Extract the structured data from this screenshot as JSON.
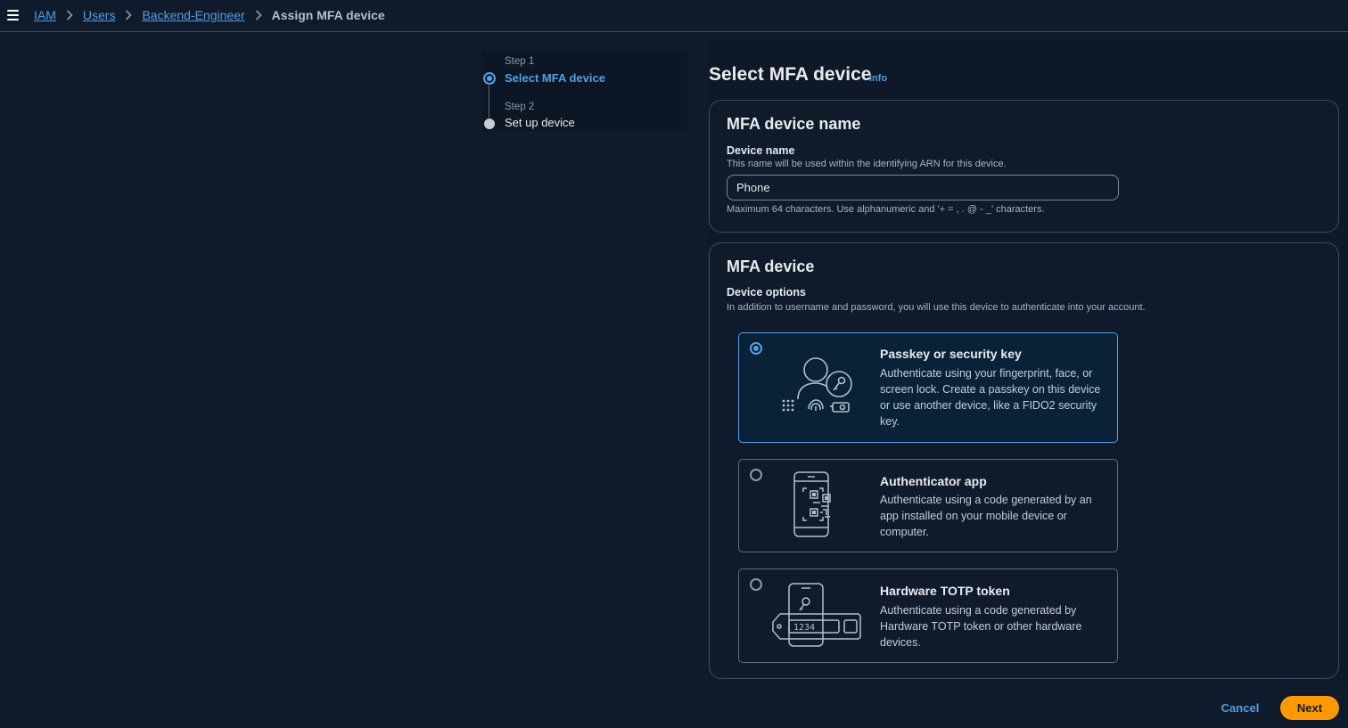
{
  "breadcrumb": {
    "items": [
      "IAM",
      "Users",
      "Backend-Engineer"
    ],
    "current": "Assign MFA device"
  },
  "steps": [
    {
      "label": "Step 1",
      "name": "Select MFA device",
      "state": "active"
    },
    {
      "label": "Step 2",
      "name": "Set up device",
      "state": "pending"
    }
  ],
  "page": {
    "title": "Select MFA device",
    "info": "Info"
  },
  "device_name_section": {
    "heading": "MFA device name",
    "label": "Device name",
    "description": "This name will be used within the identifying ARN for this device.",
    "value": "Phone",
    "constraint": "Maximum 64 characters. Use alphanumeric and '+ = , . @ - _' characters."
  },
  "mfa_device_section": {
    "heading": "MFA device",
    "label": "Device options",
    "description": "In addition to username and password, you will use this device to authenticate into your account.",
    "options": [
      {
        "title": "Passkey or security key",
        "description": "Authenticate using your fingerprint, face, or screen lock. Create a passkey on this device or use another device, like a FIDO2 security key.",
        "icon": "passkey-icon",
        "selected": true
      },
      {
        "title": "Authenticator app",
        "description": "Authenticate using a code generated by an app installed on your mobile device or computer.",
        "icon": "authenticator-app-icon",
        "selected": false
      },
      {
        "title": "Hardware TOTP token",
        "description": "Authenticate using a code generated by Hardware TOTP token or other hardware devices.",
        "icon": "hardware-token-icon",
        "token_code": "1234",
        "selected": false
      }
    ]
  },
  "actions": {
    "cancel": "Cancel",
    "next": "Next"
  },
  "colors": {
    "background": "#0f1b2a",
    "link": "#539fe5",
    "primary_button": "#ff9900",
    "border": "#414d5c"
  }
}
